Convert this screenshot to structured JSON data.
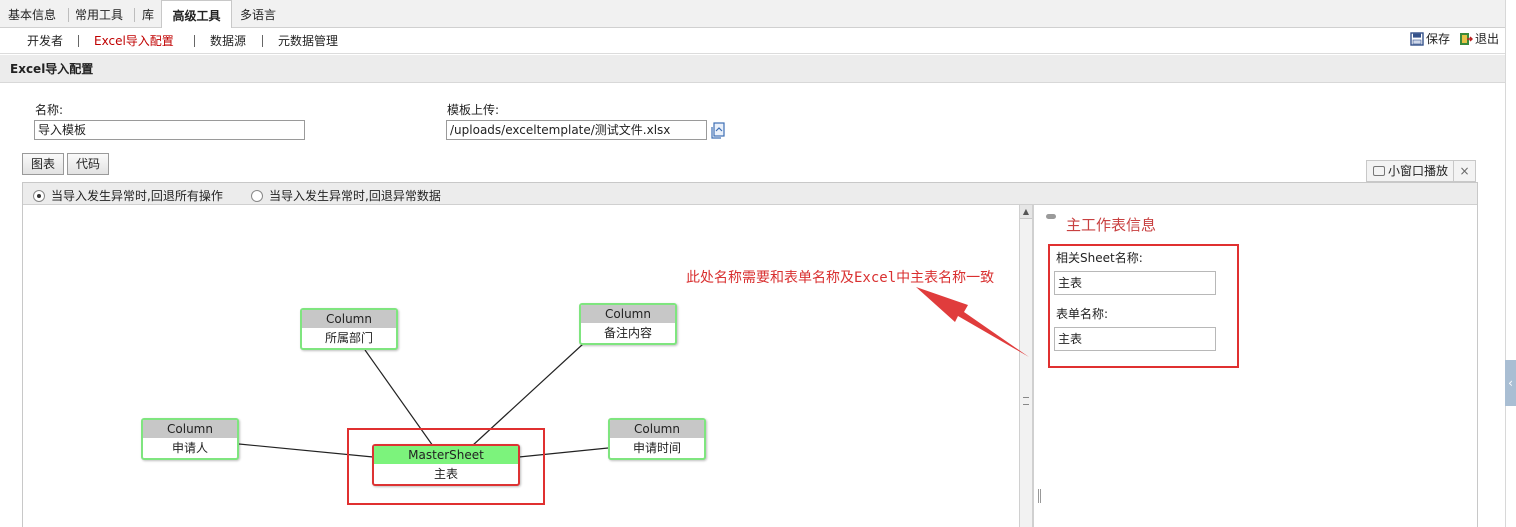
{
  "top_tabs": [
    "基本信息",
    "常用工具",
    "库",
    "高级工具",
    "多语言"
  ],
  "top_tabs_active": "高级工具",
  "sub_nav": [
    "开发者",
    "Excel导入配置",
    "数据源",
    "元数据管理"
  ],
  "sub_nav_active": "Excel导入配置",
  "toolbar": {
    "save_label": "保存",
    "exit_label": "退出"
  },
  "section_title": "Excel导入配置",
  "form": {
    "name_label": "名称:",
    "name_value": "导入模板",
    "template_label": "模板上传:",
    "template_value": "/uploads/exceltemplate/测试文件.xlsx"
  },
  "view_buttons": [
    "图表",
    "代码"
  ],
  "float_button": {
    "label": "小窗口播放",
    "close": "×"
  },
  "radio_options": [
    {
      "label": "当导入发生异常时,回退所有操作",
      "checked": true
    },
    {
      "label": "当导入发生异常时,回退异常数据",
      "checked": false
    }
  ],
  "diagram": {
    "nodes": [
      {
        "id": "dept",
        "header": "Column",
        "body": "所属部门"
      },
      {
        "id": "note",
        "header": "Column",
        "body": "备注内容"
      },
      {
        "id": "applicant",
        "header": "Column",
        "body": "申请人"
      },
      {
        "id": "time",
        "header": "Column",
        "body": "申请时间"
      },
      {
        "id": "master",
        "header": "MasterSheet",
        "body": "主表"
      }
    ]
  },
  "right_panel": {
    "title": "主工作表信息",
    "sheet_name_label": "相关Sheet名称:",
    "sheet_name_value": "主表",
    "form_name_label": "表单名称:",
    "form_name_value": "主表"
  },
  "annotation": "此处名称需要和表单名称及Excel中主表名称一致",
  "colors": {
    "accent_red": "#d93030",
    "node_green": "#7fe57f",
    "master_header": "#7cf37c"
  }
}
